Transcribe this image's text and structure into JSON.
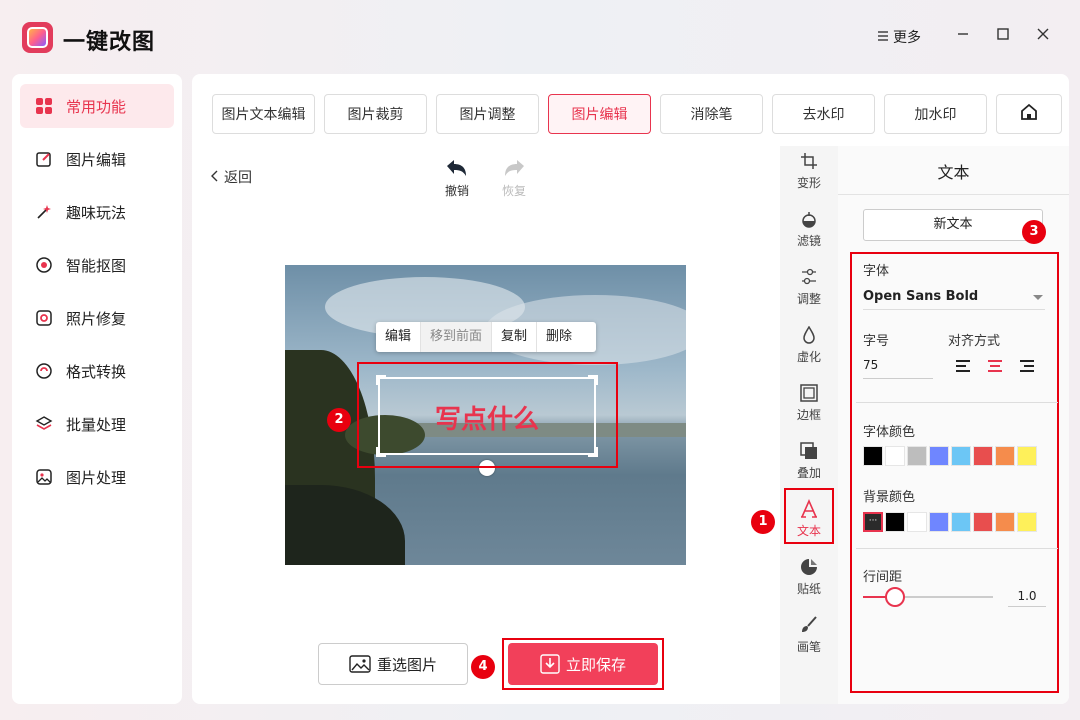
{
  "app": {
    "title": "一键改图",
    "more_label": "更多"
  },
  "colors": {
    "accent": "#e8344e",
    "highlight": "#e8000f",
    "save_button": "#f2405a"
  },
  "sidebar": {
    "items": [
      {
        "label": "常用功能",
        "icon": "grid-icon",
        "active": true
      },
      {
        "label": "图片编辑",
        "icon": "edit-icon"
      },
      {
        "label": "趣味玩法",
        "icon": "magic-wand-icon"
      },
      {
        "label": "智能抠图",
        "icon": "target-icon"
      },
      {
        "label": "照片修复",
        "icon": "repair-icon"
      },
      {
        "label": "格式转换",
        "icon": "convert-icon"
      },
      {
        "label": "批量处理",
        "icon": "layers-icon"
      },
      {
        "label": "图片处理",
        "icon": "image-icon"
      }
    ]
  },
  "tabs": {
    "items": [
      {
        "label": "图片文本编辑"
      },
      {
        "label": "图片裁剪"
      },
      {
        "label": "图片调整"
      },
      {
        "label": "图片编辑",
        "active": true
      },
      {
        "label": "消除笔"
      },
      {
        "label": "去水印"
      },
      {
        "label": "加水印"
      }
    ]
  },
  "editor": {
    "back_label": "返回",
    "undo_label": "撤销",
    "redo_label": "恢复",
    "context_menu": {
      "edit": "编辑",
      "bring_front": "移到前面",
      "copy": "复制",
      "delete": "删除"
    },
    "text_content": "写点什么",
    "reselect_label": "重选图片",
    "save_label": "立即保存"
  },
  "badges": {
    "b1": "1",
    "b2": "2",
    "b3": "3",
    "b4": "4"
  },
  "tools": {
    "items": [
      {
        "label": "变形",
        "icon": "crop-icon"
      },
      {
        "label": "滤镜",
        "icon": "filter-icon"
      },
      {
        "label": "调整",
        "icon": "adjust-icon"
      },
      {
        "label": "虚化",
        "icon": "blur-drop-icon"
      },
      {
        "label": "边框",
        "icon": "frame-icon"
      },
      {
        "label": "叠加",
        "icon": "overlay-icon"
      },
      {
        "label": "文本",
        "icon": "text-icon",
        "active": true
      },
      {
        "label": "贴纸",
        "icon": "sticker-icon"
      },
      {
        "label": "画笔",
        "icon": "brush-icon"
      }
    ]
  },
  "panel": {
    "title": "文本",
    "new_text_label": "新文本",
    "font_label": "字体",
    "font_value": "Open Sans Bold",
    "size_label": "字号",
    "size_value": "75",
    "align_label": "对齐方式",
    "font_color_label": "字体颜色",
    "font_colors": [
      "#000000",
      "#ffffff",
      "#bdbdbd",
      "#6f86ff",
      "#6cc6f5",
      "#e84e4e",
      "#f58c4c",
      "#fef05a"
    ],
    "bg_color_label": "背景颜色",
    "bg_colors": [
      "#2b2b2b",
      "#000000",
      "#ffffff",
      "#6f86ff",
      "#6cc6f5",
      "#e84e4e",
      "#f58c4c",
      "#fef05a"
    ],
    "line_height_label": "行间距",
    "line_height_value": "1.0"
  }
}
